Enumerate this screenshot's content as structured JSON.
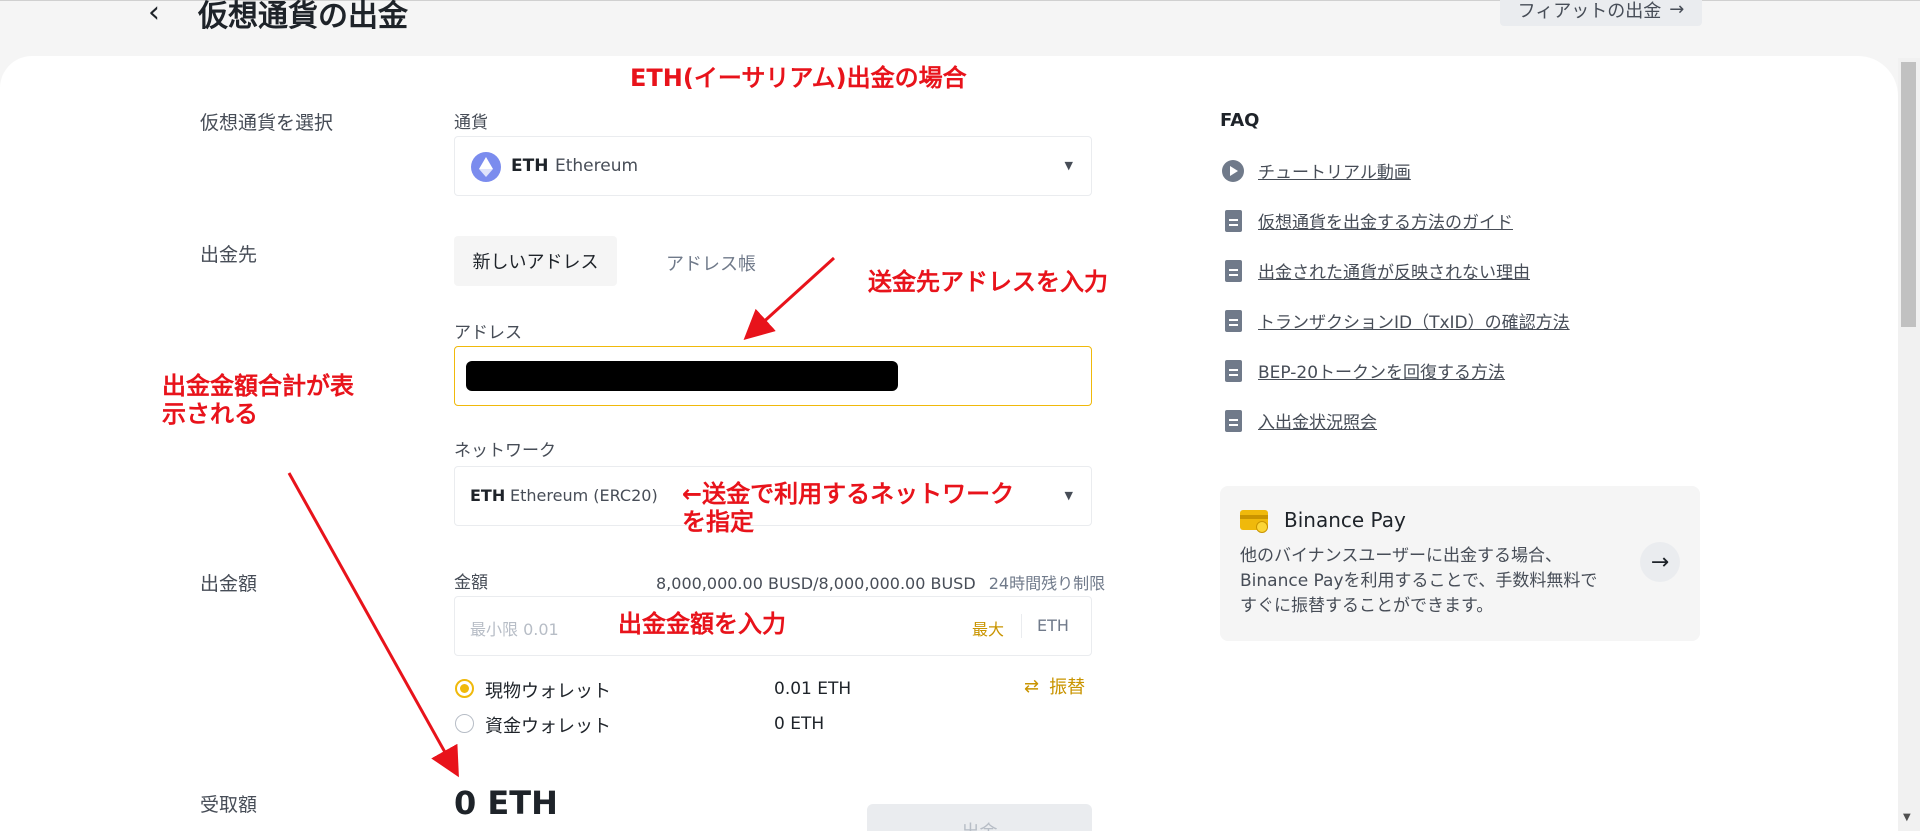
{
  "header": {
    "title": "仮想通貨の出金",
    "fiat_button": "フィアットの出金",
    "fiat_arrow": "→"
  },
  "form": {
    "select_crypto_label": "仮想通貨を選択",
    "currency_label": "通貨",
    "currency_symbol": "ETH",
    "currency_name": "Ethereum",
    "destination_label": "出金先",
    "tab_new_address": "新しいアドレス",
    "tab_address_book": "アドレス帳",
    "address_label": "アドレス",
    "network_label": "ネットワーク",
    "network_symbol": "ETH",
    "network_name": "Ethereum (ERC20)",
    "withdraw_amount_label": "出金額",
    "amount_label": "金額",
    "amount_limit": "8,000,000.00 BUSD/8,000,000.00 BUSD",
    "amount_limit_suffix": "24時間残り制限",
    "amount_placeholder": "最小限 0.01",
    "max_label": "最大",
    "amount_unit": "ETH",
    "wallets": [
      {
        "label": "現物ウォレット",
        "value": "0.01 ETH",
        "selected": true
      },
      {
        "label": "資金ウォレット",
        "value": "0 ETH",
        "selected": false
      }
    ],
    "transfer_icon": "⇄",
    "transfer_label": "振替",
    "receive_label": "受取額",
    "receive_value": "0 ETH",
    "withdraw_button": "出金"
  },
  "faq": {
    "title": "FAQ",
    "items": [
      {
        "icon": "play-icon",
        "label": "チュートリアル動画"
      },
      {
        "icon": "document-icon",
        "label": "仮想通貨を出金する方法のガイド"
      },
      {
        "icon": "document-icon",
        "label": "出金された通貨が反映されない理由"
      },
      {
        "icon": "document-icon",
        "label": "トランザクションID（TxID）の確認方法"
      },
      {
        "icon": "document-icon",
        "label": "BEP-20トークンを回復する方法"
      },
      {
        "icon": "document-icon",
        "label": "入出金状況照会"
      }
    ]
  },
  "binance_pay": {
    "title": "Binance Pay",
    "description": "他のバイナンスユーザーに出金する場合、Binance Payを利用することで、手数料無料ですぐに振替することができます。",
    "arrow": "→"
  },
  "annotations": {
    "eth_case": "ETH(イーサリアム)出金の場合",
    "enter_address": "送金先アドレスを入力",
    "total_shown_line1": "出金金額合計が表",
    "total_shown_line2": "示される",
    "network_line1": "←送金で利用するネットワーク",
    "network_line2": "を指定",
    "enter_amount": "出金金額を入力"
  },
  "colors": {
    "accent": "#f0b90b",
    "annotation": "#e8131b",
    "text": "#1e2329"
  }
}
